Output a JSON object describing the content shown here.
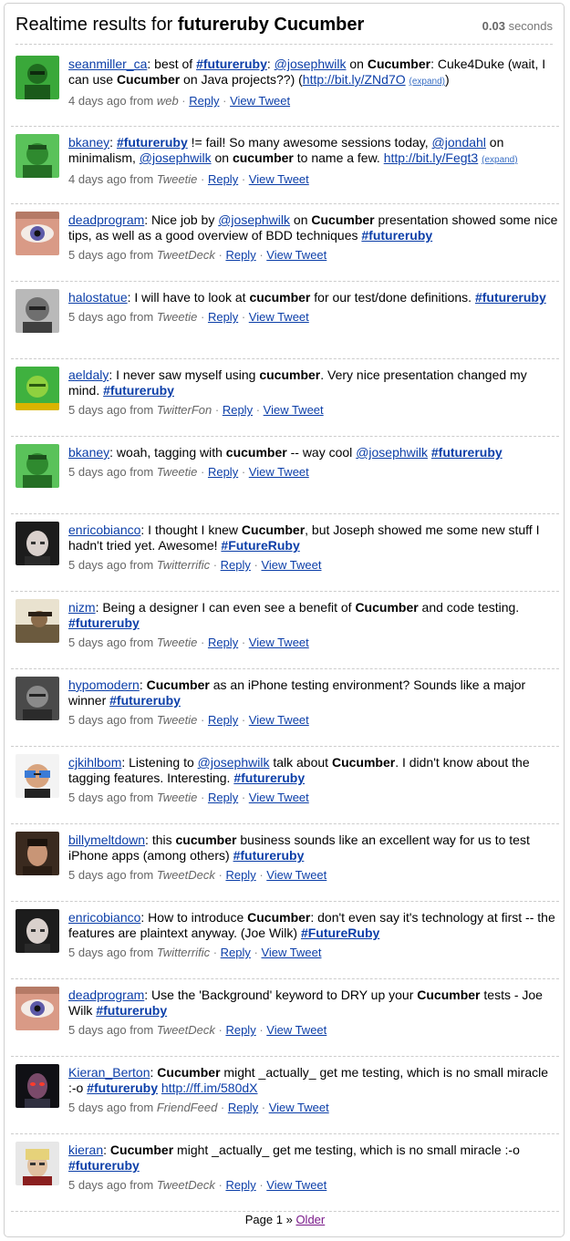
{
  "header": {
    "prefix": "Realtime results for ",
    "query": "futureruby Cucumber",
    "time_value": "0.03",
    "time_unit": " seconds"
  },
  "tweets": [
    {
      "user": "seanmiller_ca",
      "avatar": "avatar-green",
      "parts": [
        {
          "t": "user",
          "v": "seanmiller_ca"
        },
        {
          "t": "text",
          "v": ": best of "
        },
        {
          "t": "tag",
          "v": "#futureruby"
        },
        {
          "t": "text",
          "v": ": "
        },
        {
          "t": "link",
          "v": "@josephwilk"
        },
        {
          "t": "text",
          "v": " on "
        },
        {
          "t": "kw",
          "v": "Cucumber"
        },
        {
          "t": "text",
          "v": ": Cuke4Duke (wait, I can use "
        },
        {
          "t": "kw",
          "v": "Cucumber"
        },
        {
          "t": "text",
          "v": " on Java projects??) ("
        },
        {
          "t": "link",
          "v": "http://bit.ly/ZNd7O"
        },
        {
          "t": "text",
          "v": " "
        },
        {
          "t": "expand",
          "v": "(expand)"
        },
        {
          "t": "text",
          "v": ")"
        }
      ],
      "time": "4 days ago from ",
      "source": "web",
      "reply": "Reply",
      "view": "View Tweet"
    },
    {
      "user": "bkaney",
      "avatar": "avatar-green2",
      "parts": [
        {
          "t": "user",
          "v": "bkaney"
        },
        {
          "t": "text",
          "v": ": "
        },
        {
          "t": "tag",
          "v": "#futureruby"
        },
        {
          "t": "text",
          "v": " != fail! So many awesome sessions today, "
        },
        {
          "t": "link",
          "v": "@jondahl"
        },
        {
          "t": "text",
          "v": " on minimalism, "
        },
        {
          "t": "link",
          "v": "@josephwilk"
        },
        {
          "t": "text",
          "v": " on "
        },
        {
          "t": "kw",
          "v": "cucumber"
        },
        {
          "t": "text",
          "v": " to name a few. "
        },
        {
          "t": "link",
          "v": "http://bit.ly/Fegt3"
        },
        {
          "t": "text",
          "v": " "
        },
        {
          "t": "expand",
          "v": "(expand)"
        }
      ],
      "time": "4 days ago from ",
      "source": "Tweetie",
      "reply": "Reply",
      "view": "View Tweet"
    },
    {
      "user": "deadprogram",
      "avatar": "avatar-eye",
      "parts": [
        {
          "t": "user",
          "v": "deadprogram"
        },
        {
          "t": "text",
          "v": ": Nice job by "
        },
        {
          "t": "link",
          "v": "@josephwilk"
        },
        {
          "t": "text",
          "v": " on "
        },
        {
          "t": "kw",
          "v": "Cucumber"
        },
        {
          "t": "text",
          "v": " presentation showed some nice tips, as well as a good overview of BDD techniques "
        },
        {
          "t": "tag",
          "v": "#futureruby"
        }
      ],
      "time": "5 days ago from ",
      "source": "TweetDeck",
      "reply": "Reply",
      "view": "View Tweet"
    },
    {
      "user": "halostatue",
      "avatar": "avatar-gray",
      "parts": [
        {
          "t": "user",
          "v": "halostatue"
        },
        {
          "t": "text",
          "v": ": I will have to look at "
        },
        {
          "t": "kw",
          "v": "cucumber"
        },
        {
          "t": "text",
          "v": " for our test/done definitions. "
        },
        {
          "t": "tag",
          "v": "#futureruby"
        }
      ],
      "time": "5 days ago from ",
      "source": "Tweetie",
      "reply": "Reply",
      "view": "View Tweet"
    },
    {
      "user": "aeldaly",
      "avatar": "avatar-green3",
      "parts": [
        {
          "t": "user",
          "v": "aeldaly"
        },
        {
          "t": "text",
          "v": ": I never saw myself using "
        },
        {
          "t": "kw",
          "v": "cucumber"
        },
        {
          "t": "text",
          "v": ". Very nice presentation changed my mind. "
        },
        {
          "t": "tag",
          "v": "#futureruby"
        }
      ],
      "time": "5 days ago from ",
      "source": "TwitterFon",
      "reply": "Reply",
      "view": "View Tweet"
    },
    {
      "user": "bkaney",
      "avatar": "avatar-green2",
      "parts": [
        {
          "t": "user",
          "v": "bkaney"
        },
        {
          "t": "text",
          "v": ": woah, tagging with "
        },
        {
          "t": "kw",
          "v": "cucumber"
        },
        {
          "t": "text",
          "v": " -- way cool "
        },
        {
          "t": "link",
          "v": "@josephwilk"
        },
        {
          "t": "text",
          "v": " "
        },
        {
          "t": "tag",
          "v": "#futureruby"
        }
      ],
      "time": "5 days ago from ",
      "source": "Tweetie",
      "reply": "Reply",
      "view": "View Tweet"
    },
    {
      "user": "enricobianco",
      "avatar": "avatar-bald",
      "parts": [
        {
          "t": "user",
          "v": "enricobianco"
        },
        {
          "t": "text",
          "v": ": I thought I knew "
        },
        {
          "t": "kw",
          "v": "Cucumber"
        },
        {
          "t": "text",
          "v": ", but Joseph showed me some new stuff I hadn't tried yet. Awesome! "
        },
        {
          "t": "tag",
          "v": "#FutureRuby"
        }
      ],
      "time": "5 days ago from ",
      "source": "Twitterrific",
      "reply": "Reply",
      "view": "View Tweet"
    },
    {
      "user": "nizm",
      "avatar": "avatar-car",
      "parts": [
        {
          "t": "user",
          "v": "nizm"
        },
        {
          "t": "text",
          "v": ": Being a designer I can even see a benefit of "
        },
        {
          "t": "kw",
          "v": "Cucumber"
        },
        {
          "t": "text",
          "v": " and code testing. "
        },
        {
          "t": "tag",
          "v": "#futureruby"
        }
      ],
      "time": "5 days ago from ",
      "source": "Tweetie",
      "reply": "Reply",
      "view": "View Tweet"
    },
    {
      "user": "hypomodern",
      "avatar": "avatar-dark",
      "parts": [
        {
          "t": "user",
          "v": "hypomodern"
        },
        {
          "t": "text",
          "v": ": "
        },
        {
          "t": "kw",
          "v": "Cucumber"
        },
        {
          "t": "text",
          "v": " as an iPhone testing environment? Sounds like a major winner "
        },
        {
          "t": "tag",
          "v": "#futureruby"
        }
      ],
      "time": "5 days ago from ",
      "source": "Tweetie",
      "reply": "Reply",
      "view": "View Tweet"
    },
    {
      "user": "cjkihlbom",
      "avatar": "avatar-glasses",
      "parts": [
        {
          "t": "user",
          "v": "cjkihlbom"
        },
        {
          "t": "text",
          "v": ": Listening to "
        },
        {
          "t": "link",
          "v": "@josephwilk"
        },
        {
          "t": "text",
          "v": " talk about "
        },
        {
          "t": "kw",
          "v": "Cucumber"
        },
        {
          "t": "text",
          "v": ". I didn't know about the tagging features. Interesting. "
        },
        {
          "t": "tag",
          "v": "#futureruby"
        }
      ],
      "time": "5 days ago from ",
      "source": "Tweetie",
      "reply": "Reply",
      "view": "View Tweet"
    },
    {
      "user": "billymeltdown",
      "avatar": "avatar-brown",
      "parts": [
        {
          "t": "user",
          "v": "billymeltdown"
        },
        {
          "t": "text",
          "v": ": this "
        },
        {
          "t": "kw",
          "v": "cucumber"
        },
        {
          "t": "text",
          "v": " business sounds like an excellent way for us to test iPhone apps (among others) "
        },
        {
          "t": "tag",
          "v": "#futureruby"
        }
      ],
      "time": "5 days ago from ",
      "source": "TweetDeck",
      "reply": "Reply",
      "view": "View Tweet"
    },
    {
      "user": "enricobianco",
      "avatar": "avatar-bald",
      "parts": [
        {
          "t": "user",
          "v": "enricobianco"
        },
        {
          "t": "text",
          "v": ": How to introduce "
        },
        {
          "t": "kw",
          "v": "Cucumber"
        },
        {
          "t": "text",
          "v": ": don't even say it's technology at first -- the features are plaintext anyway. (Joe Wilk) "
        },
        {
          "t": "tag",
          "v": "#FutureRuby"
        }
      ],
      "time": "5 days ago from ",
      "source": "Twitterrific",
      "reply": "Reply",
      "view": "View Tweet"
    },
    {
      "user": "deadprogram",
      "avatar": "avatar-eye",
      "parts": [
        {
          "t": "user",
          "v": "deadprogram"
        },
        {
          "t": "text",
          "v": ": Use the 'Background' keyword to DRY up your "
        },
        {
          "t": "kw",
          "v": "Cucumber"
        },
        {
          "t": "text",
          "v": " tests - Joe Wilk "
        },
        {
          "t": "tag",
          "v": "#futureruby"
        }
      ],
      "time": "5 days ago from ",
      "source": "TweetDeck",
      "reply": "Reply",
      "view": "View Tweet"
    },
    {
      "user": "Kieran_Berton",
      "avatar": "avatar-red",
      "parts": [
        {
          "t": "user",
          "v": "Kieran_Berton"
        },
        {
          "t": "text",
          "v": ": "
        },
        {
          "t": "kw",
          "v": "Cucumber"
        },
        {
          "t": "text",
          "v": " might _actually_ get me testing, which is no small miracle :-o "
        },
        {
          "t": "tag",
          "v": "#futureruby"
        },
        {
          "t": "text",
          "v": " "
        },
        {
          "t": "link",
          "v": "http://ff.im/580dX"
        }
      ],
      "time": "5 days ago from ",
      "source": "FriendFeed",
      "reply": "Reply",
      "view": "View Tweet"
    },
    {
      "user": "kieran",
      "avatar": "avatar-blond",
      "parts": [
        {
          "t": "user",
          "v": "kieran"
        },
        {
          "t": "text",
          "v": ": "
        },
        {
          "t": "kw",
          "v": "Cucumber"
        },
        {
          "t": "text",
          "v": " might _actually_ get me testing, which is no small miracle :-o "
        },
        {
          "t": "tag",
          "v": "#futureruby"
        }
      ],
      "time": "5 days ago from ",
      "source": "TweetDeck",
      "reply": "Reply",
      "view": "View Tweet"
    }
  ],
  "pager": {
    "label": "Page 1",
    "sep": " » ",
    "older": "Older"
  }
}
